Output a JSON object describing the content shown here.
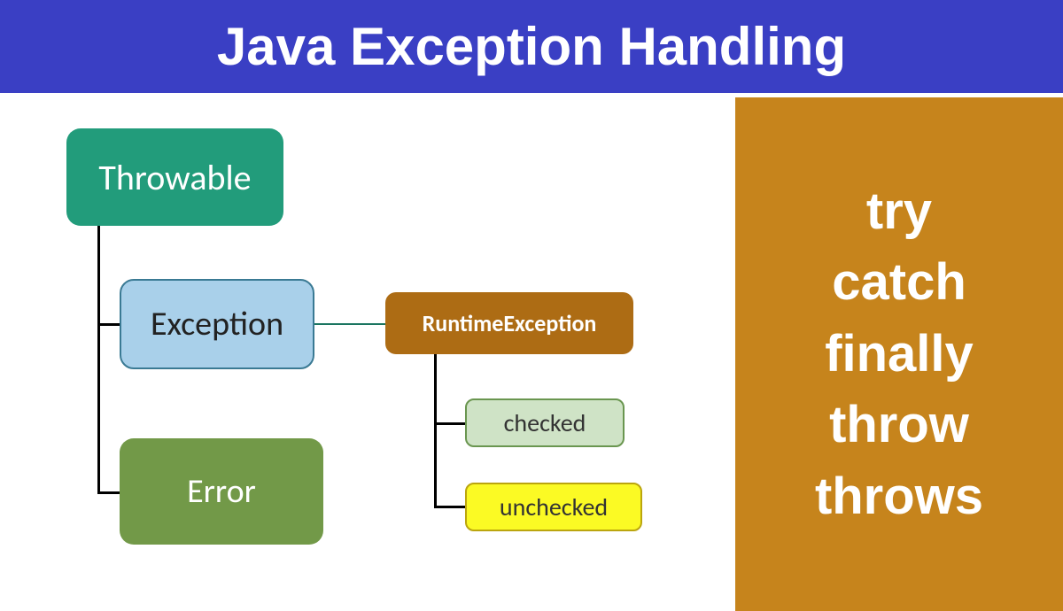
{
  "header": {
    "title": "Java Exception Handling"
  },
  "diagram": {
    "throwable": "Throwable",
    "exception": "Exception",
    "error": "Error",
    "runtime": "RuntimeException",
    "checked": "checked",
    "unchecked": "unchecked"
  },
  "keywords": {
    "k1": "try",
    "k2": "catch",
    "k3": "finally",
    "k4": "throw",
    "k5": "throws"
  }
}
